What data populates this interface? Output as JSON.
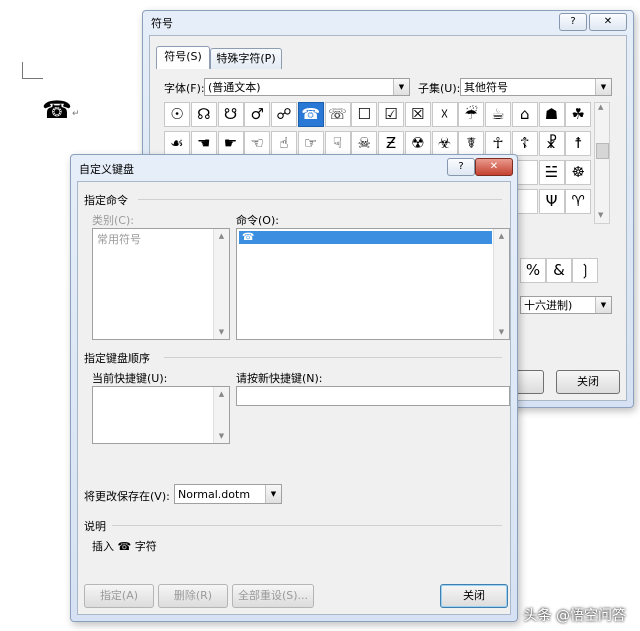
{
  "document": {
    "glyph": "☎",
    "para_mark": "↵"
  },
  "symbol_dialog": {
    "title": "符号",
    "help": "?",
    "close": "✕",
    "tabs": [
      {
        "label": "符号(S)"
      },
      {
        "label": "特殊字符(P)"
      }
    ],
    "font_label": "字体(F):",
    "font_value": "(普通文本)",
    "subset_label": "子集(U):",
    "subset_value": "其他符号",
    "grid_rows": [
      [
        "☉",
        "☊",
        "☋",
        "♂",
        "☍",
        "☎",
        "☏",
        "☐",
        "☑",
        "☒",
        "☓",
        "☔",
        "☕",
        "⌂",
        "☗",
        "☘"
      ],
      [
        "☙",
        "☚",
        "☛",
        "☜",
        "☝",
        "☞",
        "☟",
        "☠",
        "Ƶ",
        "☢",
        "☣",
        "☤",
        "☥",
        "☦",
        "☧",
        "☨"
      ],
      [
        "",
        "",
        "",
        "",
        "",
        "",
        "",
        "",
        "",
        "",
        "",
        "",
        "",
        "",
        "☱",
        "☸"
      ],
      [
        "",
        "",
        "",
        "",
        "",
        "",
        "",
        "",
        "",
        "",
        "",
        "",
        "",
        "",
        "Ψ",
        "♈"
      ]
    ],
    "recent_symbols": [
      "%",
      "&",
      "❳"
    ],
    "code_from_value": "十六进制)",
    "close_button": "关闭"
  },
  "keyboard_dialog": {
    "title": "自定义键盘",
    "help": "?",
    "close": "✕",
    "specify_command": "指定命令",
    "category_label": "类别(C):",
    "categories": [
      "常用符号"
    ],
    "command_label": "命令(O):",
    "commands": [
      "☎"
    ],
    "specify_sequence": "指定键盘顺序",
    "current_keys_label": "当前快捷键(U):",
    "new_key_label": "请按新快捷键(N):",
    "new_key_value": "",
    "save_in_label": "将更改保存在(V):",
    "save_in_value": "Normal.dotm",
    "description_label": "说明",
    "description_text": "插入 ☎ 字符",
    "buttons": {
      "assign": "指定(A)",
      "remove": "删除(R)",
      "reset_all": "全部重设(S)...",
      "close": "关闭"
    }
  },
  "watermark": "头条 @悟空问答"
}
